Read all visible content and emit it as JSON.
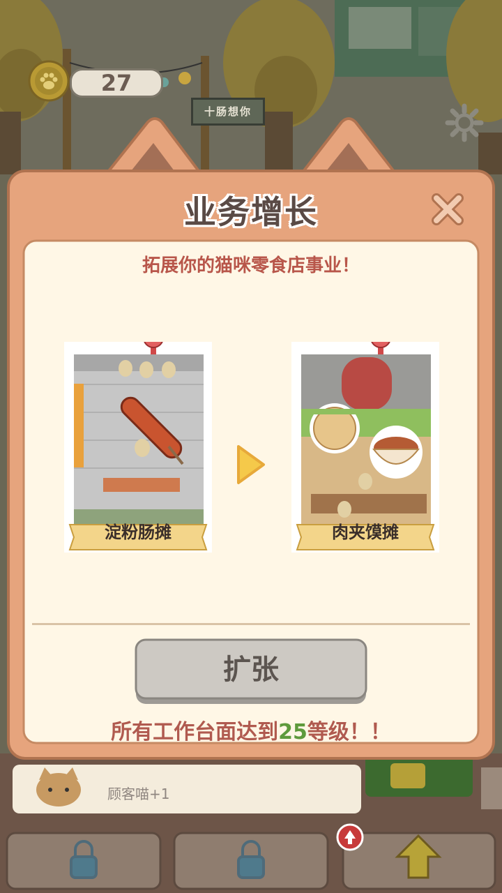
{
  "hud": {
    "coins": "27",
    "sign_text": "十肠想你"
  },
  "dialog": {
    "title": "业务增长",
    "subtitle": "拓展你的猫咪零食店事业！",
    "current_shop": "淀粉肠摊",
    "next_shop": "肉夹馍摊",
    "expand_label": "扩张",
    "requirement_prefix": "所有工作台面达到",
    "requirement_level": "25",
    "requirement_suffix": "等级！！"
  },
  "bottom": {
    "customer_text": "顾客喵+1"
  },
  "colors": {
    "frame": "#e6a47d",
    "panel": "#fff7e6",
    "title": "#5a4a45",
    "subtitle": "#b8564a",
    "requirement_level": "#5e9a3c",
    "button": "#c9c5bf"
  }
}
